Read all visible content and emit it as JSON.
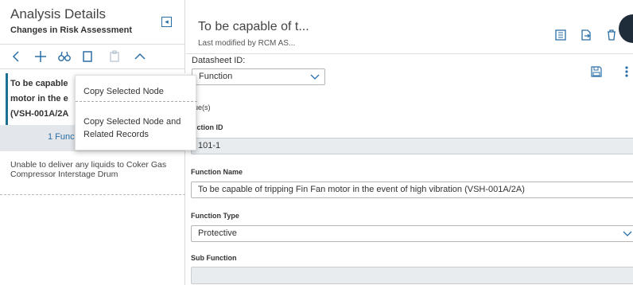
{
  "left_panel": {
    "title": "Analysis Details",
    "subtitle": "Changes in Risk Assessment",
    "node_text_lines": [
      "To be capable",
      "motor in the e",
      "(VSH-001A/2A"
    ],
    "node_bar_text": "1 Funct",
    "list_item": "Unable to deliver any liquids to Coker Gas Compressor Interstage Drum"
  },
  "context_menu": {
    "items": [
      "Copy Selected Node",
      "Copy Selected Node and Related Records"
    ]
  },
  "datasheet": {
    "title": "To be capable of t...",
    "modified": "Last modified by RCM AS...",
    "datasheet_id_label": "Datasheet ID:",
    "datasheet_id_value": "Function",
    "values_label": "lue(s)",
    "fields": {
      "function_id_label": "nction ID",
      "function_id_value": "101-1",
      "function_name_label": "Function Name",
      "function_name_value": "To be capable of tripping Fin Fan motor in the event of high vibration (VSH-001A/2A)",
      "function_type_label": "Function Type",
      "function_type_value": "Protective",
      "sub_function_label": "Sub Function",
      "sub_function_value": ""
    }
  },
  "colors": {
    "accent": "#2a6ea6",
    "node_border": "#1b6f92",
    "panel_gray": "#e3e6ea"
  }
}
